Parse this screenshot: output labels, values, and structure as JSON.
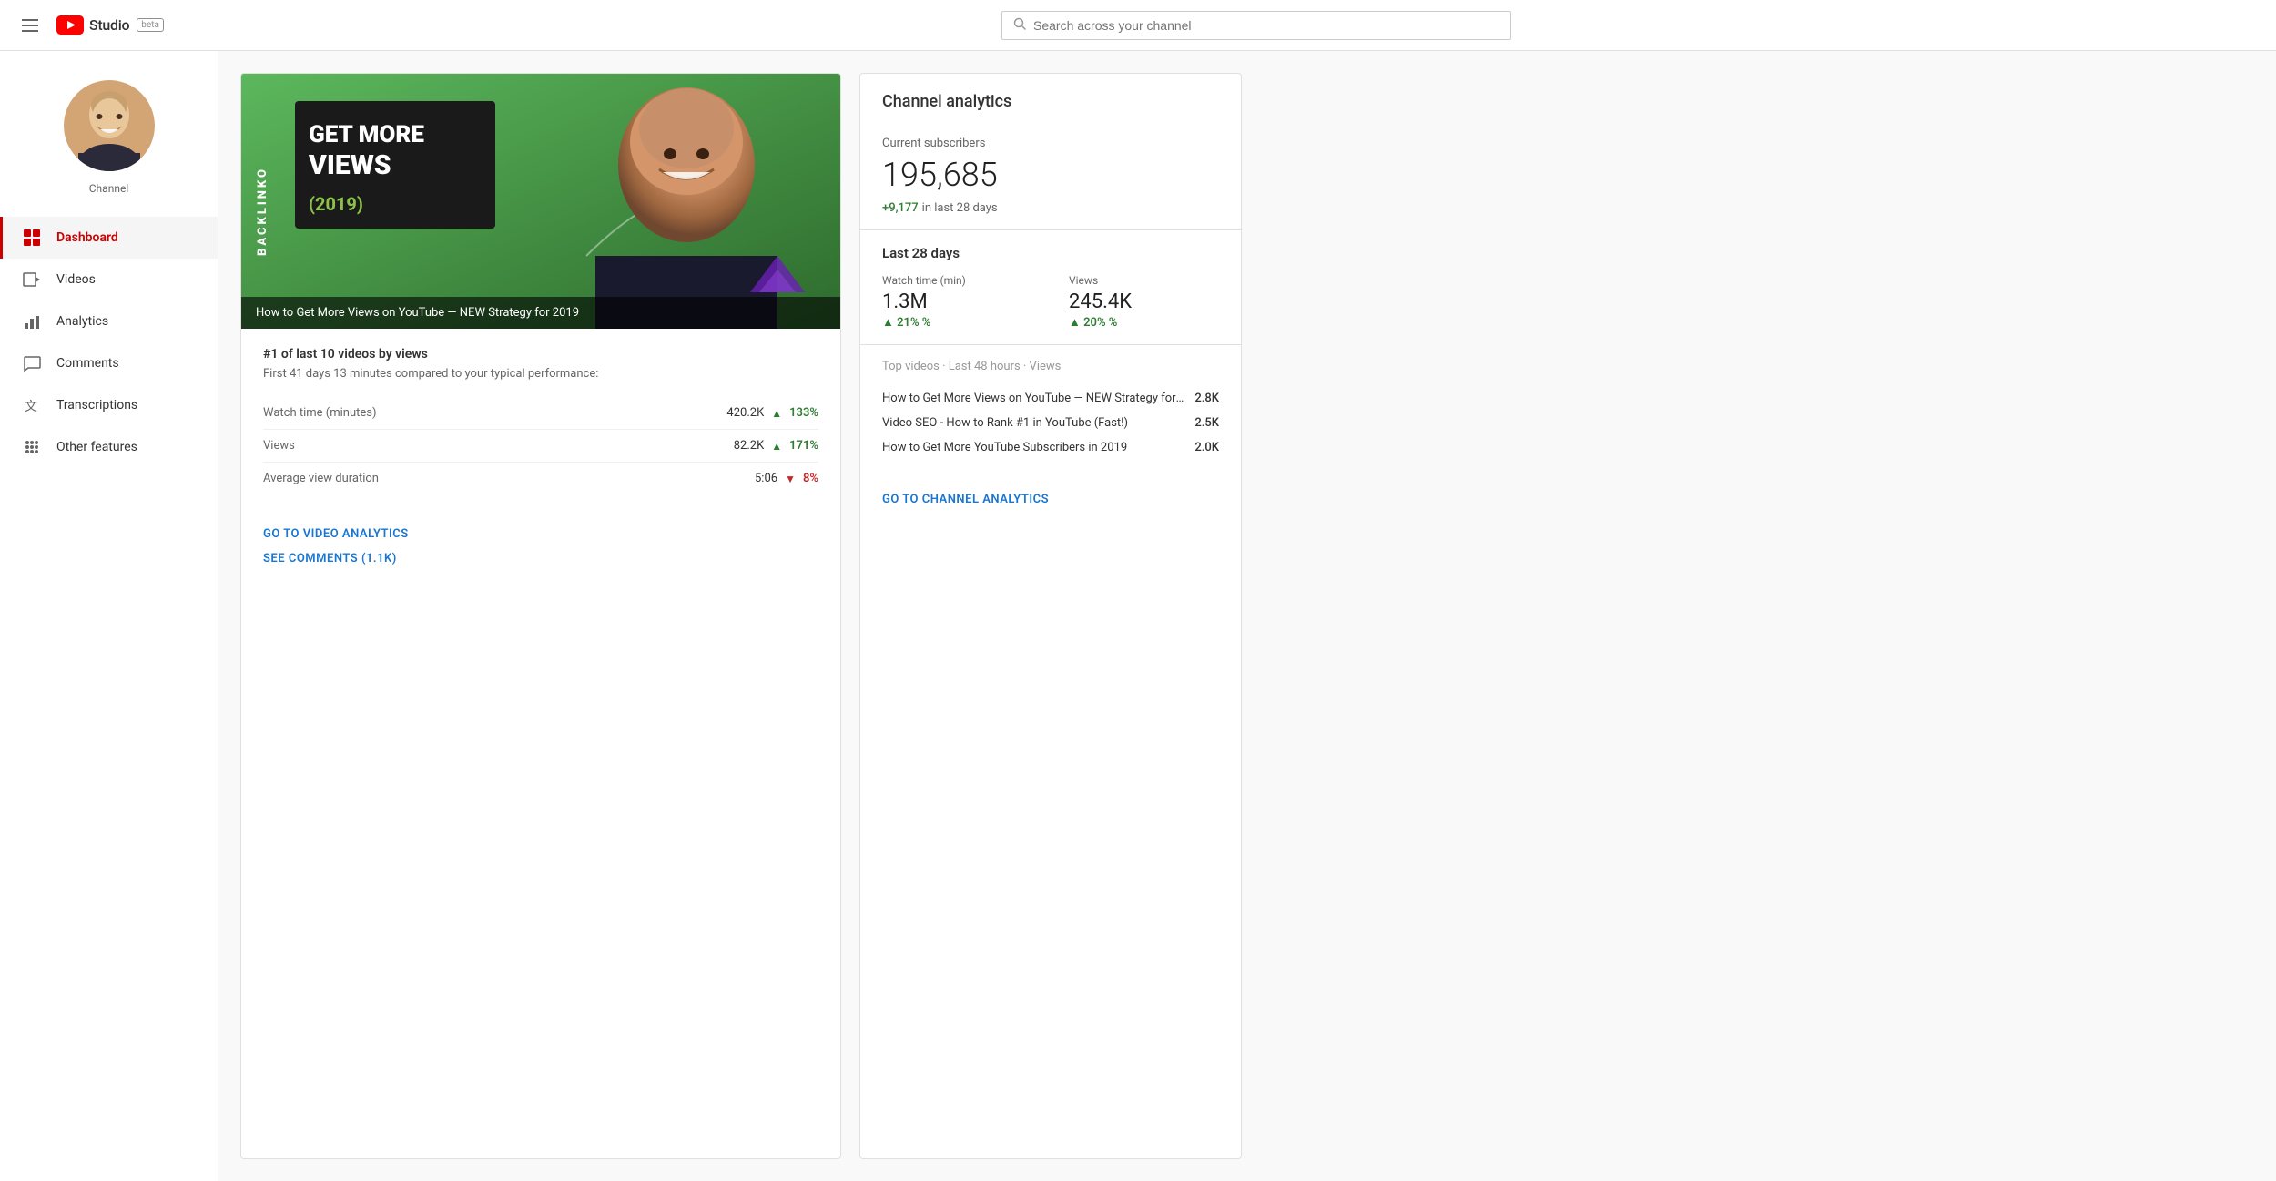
{
  "topnav": {
    "search_placeholder": "Search across your channel",
    "studio_label": "Studio",
    "beta_label": "beta"
  },
  "sidebar": {
    "channel_label": "Channel",
    "avatar_alt": "Channel avatar - bald man smiling",
    "items": [
      {
        "id": "dashboard",
        "label": "Dashboard",
        "icon": "grid",
        "active": true
      },
      {
        "id": "videos",
        "label": "Videos",
        "icon": "play",
        "active": false
      },
      {
        "id": "analytics",
        "label": "Analytics",
        "icon": "bar-chart",
        "active": false
      },
      {
        "id": "comments",
        "label": "Comments",
        "icon": "comment",
        "active": false
      },
      {
        "id": "transcriptions",
        "label": "Transcriptions",
        "icon": "translate",
        "active": false
      },
      {
        "id": "other-features",
        "label": "Other features",
        "icon": "apps",
        "active": false
      }
    ]
  },
  "video_card": {
    "thumbnail_caption": "How to Get More Views on YouTube — NEW Strategy for 2019",
    "channel_name": "BACKLINKO",
    "title_line1": "GET MORE",
    "title_line2": "VIEWS",
    "title_line3": "(2019)",
    "rank_text": "#1 of last 10 videos by views",
    "perf_text": "First 41 days 13 minutes compared to your typical performance:",
    "stats": [
      {
        "label": "Watch time (minutes)",
        "value": "420.2K",
        "pct": "133%",
        "direction": "up"
      },
      {
        "label": "Views",
        "value": "82.2K",
        "pct": "171%",
        "direction": "up"
      },
      {
        "label": "Average view duration",
        "value": "5:06",
        "pct": "8%",
        "direction": "down"
      }
    ],
    "link_analytics": "GO TO VIDEO ANALYTICS",
    "link_comments": "SEE COMMENTS (1.1K)"
  },
  "analytics_card": {
    "title": "Channel analytics",
    "subscribers_label": "Current subscribers",
    "subscribers_value": "195,685",
    "growth_value": "+9,177",
    "growth_note": " in last 28 days",
    "last28_label": "Last 28 days",
    "watch_time_label": "Watch time (min)",
    "watch_time_value": "1.3M",
    "watch_time_change": "21%",
    "watch_time_dir": "up",
    "views_label": "Views",
    "views_value": "245.4K",
    "views_change": "20%",
    "views_dir": "up",
    "top_videos_label": "Top videos",
    "top_videos_period": "Last 48 hours",
    "top_videos_metric": "Views",
    "top_videos": [
      {
        "title": "How to Get More Views on YouTube — NEW Strategy for …",
        "views": "2.8K"
      },
      {
        "title": "Video SEO - How to Rank #1 in YouTube (Fast!)",
        "views": "2.5K"
      },
      {
        "title": "How to Get More YouTube Subscribers in 2019",
        "views": "2.0K"
      }
    ],
    "cta_label": "GO TO CHANNEL ANALYTICS"
  }
}
